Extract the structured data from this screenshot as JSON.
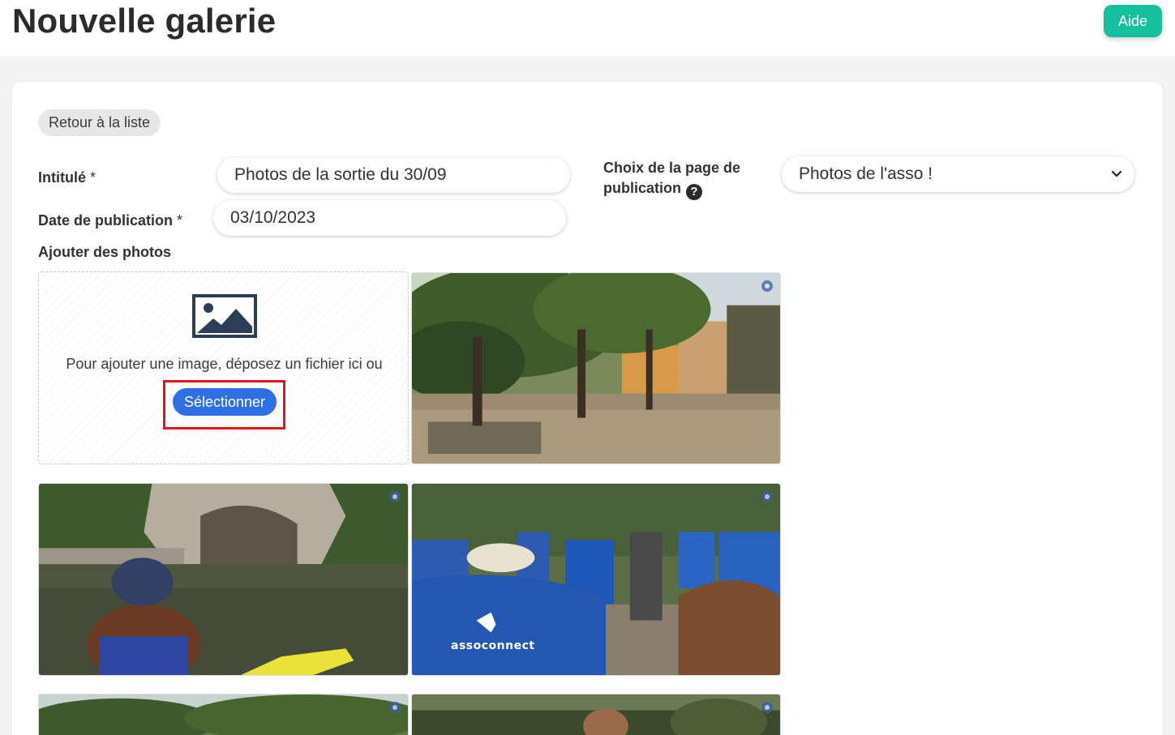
{
  "header": {
    "title": "Nouvelle galerie",
    "help_label": "Aide"
  },
  "form": {
    "back_label": "Retour à la liste",
    "title_label": "Intitulé",
    "title_value": "Photos de la sortie du 30/09",
    "page_choice_label_line1": "Choix de la page de",
    "page_choice_label_line2": "publication",
    "page_choice_value": "Photos de l'asso !",
    "date_label": "Date de publication",
    "date_value": "03/10/2023",
    "required_mark": "*",
    "photos_label": "Ajouter des photos"
  },
  "upload": {
    "instruction": "Pour ajouter une image, déposez un fichier ici ou",
    "select_label": "Sélectionner",
    "icon": "image-icon"
  },
  "gallery": {
    "photos": [
      {
        "scene": "courtyard with trees and buildings",
        "settings_icon": "gear-icon"
      },
      {
        "scene": "kayaker on river under rocky cliff",
        "settings_icon": "gear-icon"
      },
      {
        "scene": "group of people in blue assoconnect t-shirts",
        "shirt_text": "assoconnect",
        "settings_icon": "gear-icon"
      },
      {
        "scene": "trees by the river",
        "settings_icon": "gear-icon"
      },
      {
        "scene": "people in a forest",
        "settings_icon": "gear-icon"
      }
    ]
  },
  "colors": {
    "help_button": "#14c19c",
    "select_button": "#2f6fe6",
    "highlight_border": "#e5141c"
  }
}
